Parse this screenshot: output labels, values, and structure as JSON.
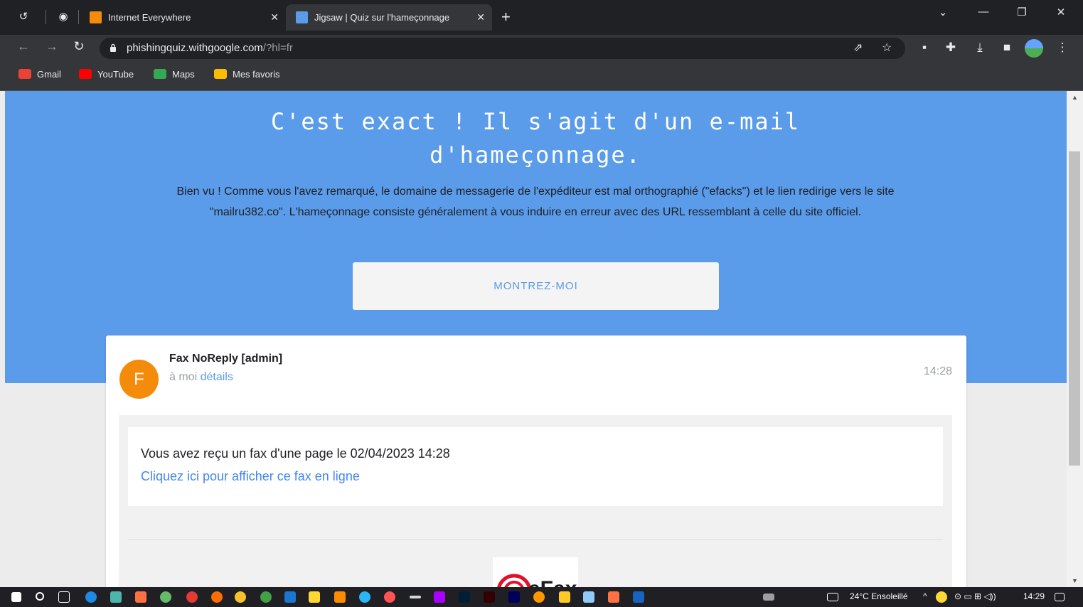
{
  "browser": {
    "tabs": [
      {
        "title": "Internet Everywhere",
        "favicon_color": "#f58b0b",
        "active": false
      },
      {
        "title": "Jigsaw | Quiz sur l'hameçonnage",
        "favicon_color": "#5a9bea",
        "active": true
      }
    ],
    "url_host": "phishingquiz.withgoogle.com",
    "url_rest": "/?hl=fr",
    "bookmarks": [
      {
        "label": "Gmail",
        "color": "#ea4335"
      },
      {
        "label": "YouTube",
        "color": "#ff0000"
      },
      {
        "label": "Maps",
        "color": "#34a853"
      },
      {
        "label": "Mes favoris",
        "color": "#fbbc04"
      }
    ]
  },
  "hero": {
    "title": "C'est exact ! Il s'agit d'un e-mail d'hameçonnage.",
    "text": "Bien vu ! Comme vous l'avez remarqué, le domaine de messagerie de l'expéditeur est mal orthographié (\"efacks\") et le lien redirige vers le site \"mailru382.co\". L'hameçonnage consiste généralement à vous induire en erreur avec des URL ressemblant à celle du site officiel.",
    "button": "MONTREZ-MOI",
    "background": "#5a9bea"
  },
  "email": {
    "avatar_letter": "F",
    "sender": "Fax NoReply [admin]",
    "to": "à moi",
    "details": "détails",
    "time": "14:28",
    "body_line": "Vous avez reçu un fax d'une page le 02/04/2023 14:28",
    "link": "Cliquez ici pour afficher ce fax en ligne",
    "logo_text": "eFax"
  },
  "taskbar": {
    "weather": "24°C  Ensoleillé",
    "time": "14:29"
  }
}
